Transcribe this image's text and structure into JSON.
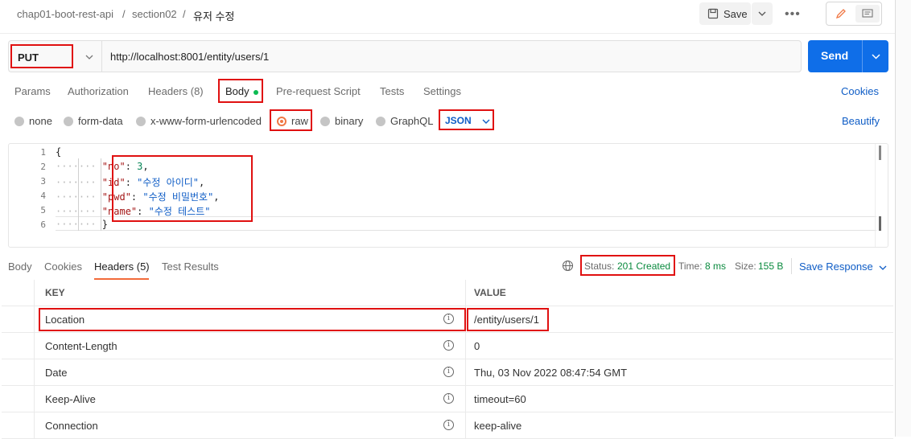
{
  "breadcrumb": {
    "part1": "chap01-boot-rest-api",
    "sep": "/",
    "part2": "section02",
    "part3": "유저 수정"
  },
  "toolbar": {
    "save_label": "Save",
    "more_label": "•••"
  },
  "request": {
    "method": "PUT",
    "url": "http://localhost:8001/entity/users/1",
    "send_label": "Send"
  },
  "request_tabs": {
    "params": "Params",
    "authorization": "Authorization",
    "headers": "Headers (8)",
    "body": "Body",
    "prescript": "Pre-request Script",
    "tests": "Tests",
    "settings": "Settings",
    "cookies": "Cookies"
  },
  "body_types": {
    "none": "none",
    "form_data": "form-data",
    "urlencoded": "x-www-form-urlencoded",
    "raw": "raw",
    "binary": "binary",
    "graphql": "GraphQL",
    "format": "JSON",
    "beautify": "Beautify"
  },
  "editor": {
    "line_numbers": [
      "1",
      "2",
      "3",
      "4",
      "5",
      "6"
    ],
    "open_brace": "{",
    "close_brace": "}",
    "fields": [
      {
        "key": "\"no\"",
        "sep": ": ",
        "value": "3",
        "tail": ","
      },
      {
        "key": "\"id\"",
        "sep": ": ",
        "value": "\"수정 아이디\"",
        "tail": ","
      },
      {
        "key": "\"pwd\"",
        "sep": ": ",
        "value": "\"수정 비밀번호\"",
        "tail": ","
      },
      {
        "key": "\"name\"",
        "sep": ": ",
        "value": "\"수정 테스트\"",
        "tail": ""
      }
    ]
  },
  "response_tabs": {
    "body": "Body",
    "cookies": "Cookies",
    "headers": "Headers (5)",
    "test_results": "Test Results"
  },
  "response_meta": {
    "status_label": "Status:",
    "status_value": "201 Created",
    "time_label": "Time:",
    "time_value": "8 ms",
    "size_label": "Size:",
    "size_value": "155 B",
    "save_response": "Save Response"
  },
  "headers_table": {
    "col_key": "KEY",
    "col_value": "VALUE",
    "rows": [
      {
        "key": "Location",
        "value": "/entity/users/1"
      },
      {
        "key": "Content-Length",
        "value": "0"
      },
      {
        "key": "Date",
        "value": "Thu, 03 Nov 2022 08:47:54 GMT"
      },
      {
        "key": "Keep-Alive",
        "value": "timeout=60"
      },
      {
        "key": "Connection",
        "value": "keep-alive"
      }
    ]
  },
  "colors": {
    "accent": "#0f6ee8",
    "highlight": "#e01010",
    "status_green": "#0a8a3e",
    "tab_underline": "#f26b3a"
  }
}
